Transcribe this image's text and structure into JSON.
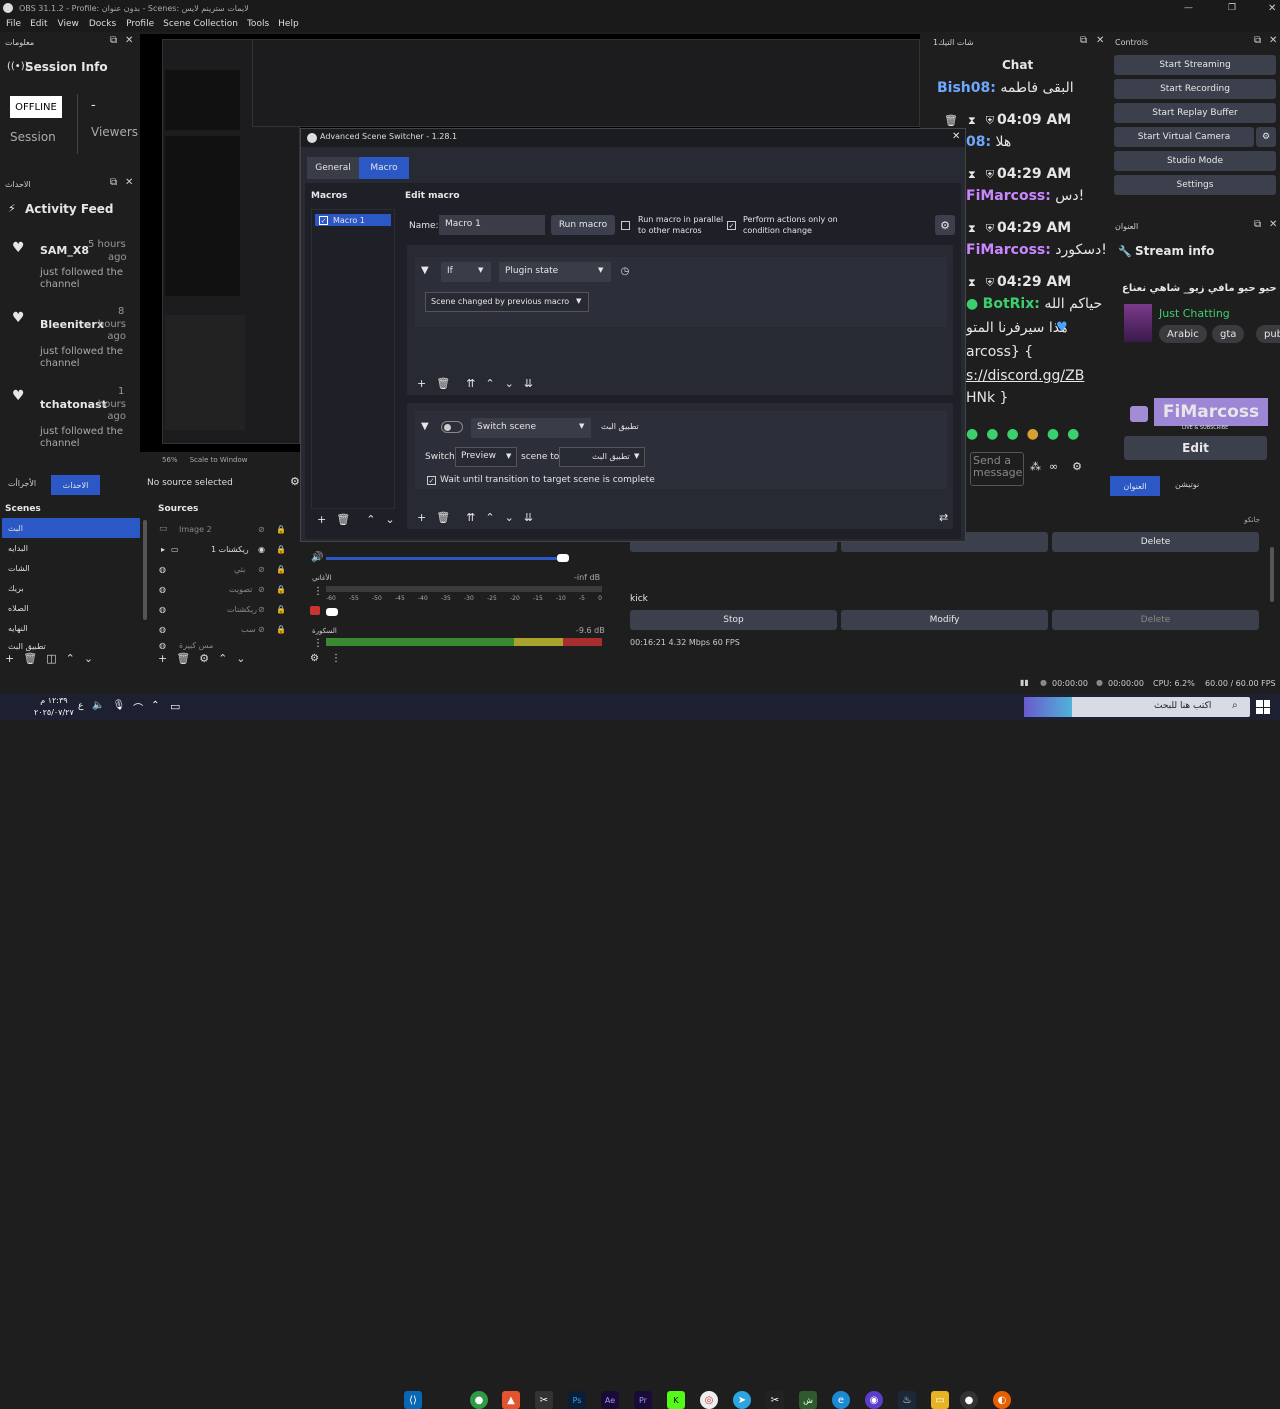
{
  "window": {
    "title": "OBS 31.1.2 - Profile: بدون عنوان - Scenes: لايمات سترينم لايس"
  },
  "menu": [
    "File",
    "Edit",
    "View",
    "Docks",
    "Profile",
    "Scene Collection",
    "Tools",
    "Help"
  ],
  "session_dock": {
    "title": "معلومات",
    "header": "Session Info",
    "status": "OFFLINE",
    "dash": "-",
    "session_label": "Session",
    "viewers_label": "Viewers"
  },
  "activity_dock": {
    "title": "الاحداث",
    "header": "Activity Feed",
    "items": [
      {
        "user": "SAM_X8",
        "time_num": "5 hours",
        "time_rest": "ago",
        "action": "just followed the channel"
      },
      {
        "user": "Bleeniterx",
        "time_num": "8",
        "time_rest": "hours ago",
        "action": "just followed the channel"
      },
      {
        "user": "tchatonast",
        "time_num": "1",
        "time_rest": "hours ago",
        "action": "just followed the channel"
      }
    ],
    "tabs": [
      "الأجراأت",
      "الاحداث"
    ]
  },
  "preview": {
    "zoom": "56%",
    "scale": "Scale to Window",
    "no_source": "No source selected"
  },
  "scenes": {
    "title": "Scenes",
    "items": [
      "البث",
      "البدايه",
      "الشات",
      "بريك",
      "الصلاه",
      "النهايه",
      "تطبيق البث"
    ]
  },
  "sources": {
    "title": "Sources",
    "items": [
      "Image 2",
      "ريكشنات 1",
      "بثي",
      "تصويت",
      "ريكشنات",
      "سب",
      "مس كبيرة"
    ]
  },
  "mixer": {
    "tracks": [
      {
        "name": "الأغاني",
        "db": "-inf dB"
      },
      {
        "name": "السكورة",
        "db": "-9.6 dB"
      }
    ],
    "ticks": [
      "-60",
      "-55",
      "-50",
      "-45",
      "-40",
      "-35",
      "-30",
      "-25",
      "-20",
      "-15",
      "-10",
      "-5",
      "0"
    ]
  },
  "dialog": {
    "title": "Advanced Scene Switcher - 1.28.1",
    "tabs": [
      "General",
      "Macro"
    ],
    "macros_label": "Macros",
    "macro_items": [
      "Macro 1"
    ],
    "edit_label": "Edit macro",
    "name_label": "Name:",
    "name_value": "Macro 1",
    "run_macro": "Run macro",
    "parallel_label": "Run macro in parallel to other macros",
    "condition_label": "Perform actions only on condition change",
    "cond_if": "If",
    "cond_type": "Plugin state",
    "cond_state": "Scene changed by previous macro",
    "action_type": "Switch scene",
    "action_target": "تطبيق البث",
    "switch_label": "Switch",
    "switch_mode": "Preview",
    "scene_to_label": "scene to",
    "scene_to_value": "تطبيق البث",
    "wait_label": "Wait until transition to target scene is complete"
  },
  "chat_dock": {
    "title": "شات التيك1",
    "header": "Chat",
    "messages": [
      {
        "user": "Bish08:",
        "text": "البقى فاطمه"
      },
      {
        "time": "04:09 AM",
        "user": "08:",
        "text": "هلا"
      },
      {
        "time": "04:29 AM",
        "user": "FiMarcoss:",
        "text": "دس!"
      },
      {
        "time": "04:29 AM",
        "user": "FiMarcoss:",
        "text": "دسكورد!"
      },
      {
        "time": "04:29 AM",
        "user": "BotRix:",
        "text": "حياكم الله"
      },
      {
        "text": "هذا سيرفرنا المتو"
      },
      {
        "text": "arcoss} {"
      },
      {
        "text": "s://discord.gg/ZB"
      },
      {
        "text": "HNk }"
      }
    ],
    "send_placeholder": "Send a message",
    "tabs": [
      "العنوان",
      "نوتيشن"
    ]
  },
  "controls": {
    "title": "Controls",
    "buttons": [
      "Start Streaming",
      "Start Recording",
      "Start Replay Buffer",
      "Start Virtual Camera",
      "Studio Mode",
      "Settings"
    ]
  },
  "stream_info": {
    "title": "العنوان",
    "header": "Stream info",
    "stream_title": "حيو حيو مافي زيو_ شاهي نعناع",
    "category": "Just Chatting",
    "tags": [
      "Arabic",
      "gta",
      "pub"
    ],
    "channel": "FiMarcoss",
    "channel_sub": "LIVE & SUBSCRIBE",
    "edit": "Edit"
  },
  "output_dock": {
    "header": "جانكو",
    "delete1": "Delete",
    "name": "kick",
    "stop": "Stop",
    "modify": "Modify",
    "delete2": "Delete",
    "stats": "00:16:21  4.32 Mbps  60 FPS"
  },
  "statusbar": {
    "t1": "00:00:00",
    "t2": "00:00:00",
    "cpu": "CPU: 6.2%",
    "fps": "60.00 / 60.00 FPS"
  },
  "taskbar": {
    "clock_time": "١٢:٣٩ م",
    "clock_date": "٢٠٢٥/٠٧/٢٧",
    "search": "اكتب هنا للبحث",
    "lang": "ع"
  }
}
